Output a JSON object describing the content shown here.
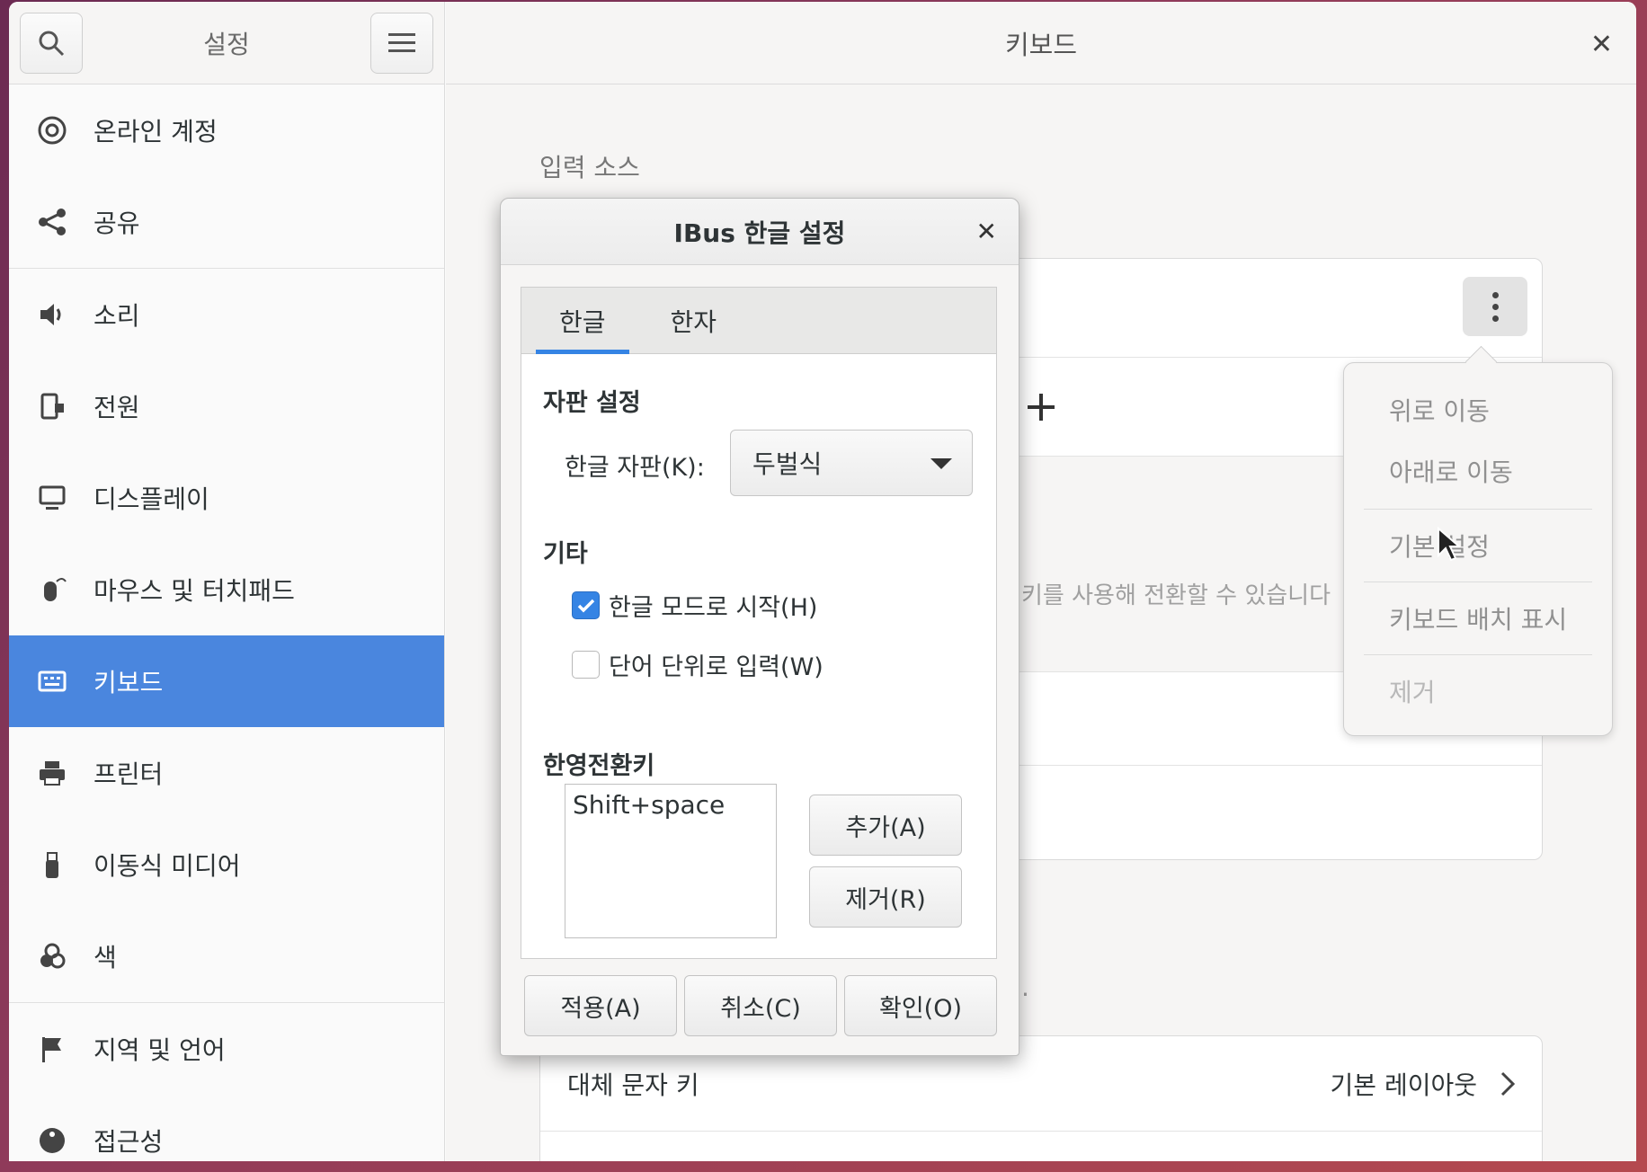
{
  "sidebar": {
    "title": "설정",
    "items": [
      {
        "label": "온라인 계정",
        "icon": "at-icon"
      },
      {
        "label": "공유",
        "icon": "share-icon"
      },
      {
        "label": "소리",
        "icon": "speaker-icon"
      },
      {
        "label": "전원",
        "icon": "power-icon"
      },
      {
        "label": "디스플레이",
        "icon": "display-icon"
      },
      {
        "label": "마우스 및 터치패드",
        "icon": "mouse-icon"
      },
      {
        "label": "키보드",
        "icon": "keyboard-icon"
      },
      {
        "label": "프린터",
        "icon": "printer-icon"
      },
      {
        "label": "이동식 미디어",
        "icon": "usb-icon"
      },
      {
        "label": "색",
        "icon": "color-icon"
      },
      {
        "label": "지역 및 언어",
        "icon": "flag-icon"
      },
      {
        "label": "접근성",
        "icon": "accessibility-icon"
      }
    ],
    "active_index": 6
  },
  "main": {
    "title": "키보드",
    "input_sources_label": "입력 소스",
    "hint_text": "키를 사용해 전환할 수 있습니다",
    "alt_chars_label": "대체 문자 키",
    "alt_chars_value": "기본 레이아웃",
    "footer_dot": "."
  },
  "popover": {
    "items": [
      {
        "label": "위로 이동"
      },
      {
        "label": "아래로 이동"
      },
      {
        "label": "기본 설정"
      },
      {
        "label": "키보드 배치 표시"
      },
      {
        "label": "제거"
      }
    ]
  },
  "dialog": {
    "title": "IBus 한글 설정",
    "tabs": [
      "한글",
      "한자"
    ],
    "layout_group": "자판 설정",
    "layout_label": "한글 자판(K):",
    "layout_value": "두벌식",
    "etc_group": "기타",
    "check_start_hangul": {
      "label": "한글 모드로 시작(H)",
      "checked": true
    },
    "check_word_unit": {
      "label": "단어 단위로 입력(W)",
      "checked": false
    },
    "toggle_group": "한영전환키",
    "toggle_keys": [
      "Shift+space"
    ],
    "add_button": "추가(A)",
    "remove_button": "제거(R)",
    "apply_button": "적용(A)",
    "cancel_button": "취소(C)",
    "ok_button": "확인(O)"
  },
  "colors": {
    "accent": "#4a86de",
    "check_blue": "#3584e4"
  }
}
